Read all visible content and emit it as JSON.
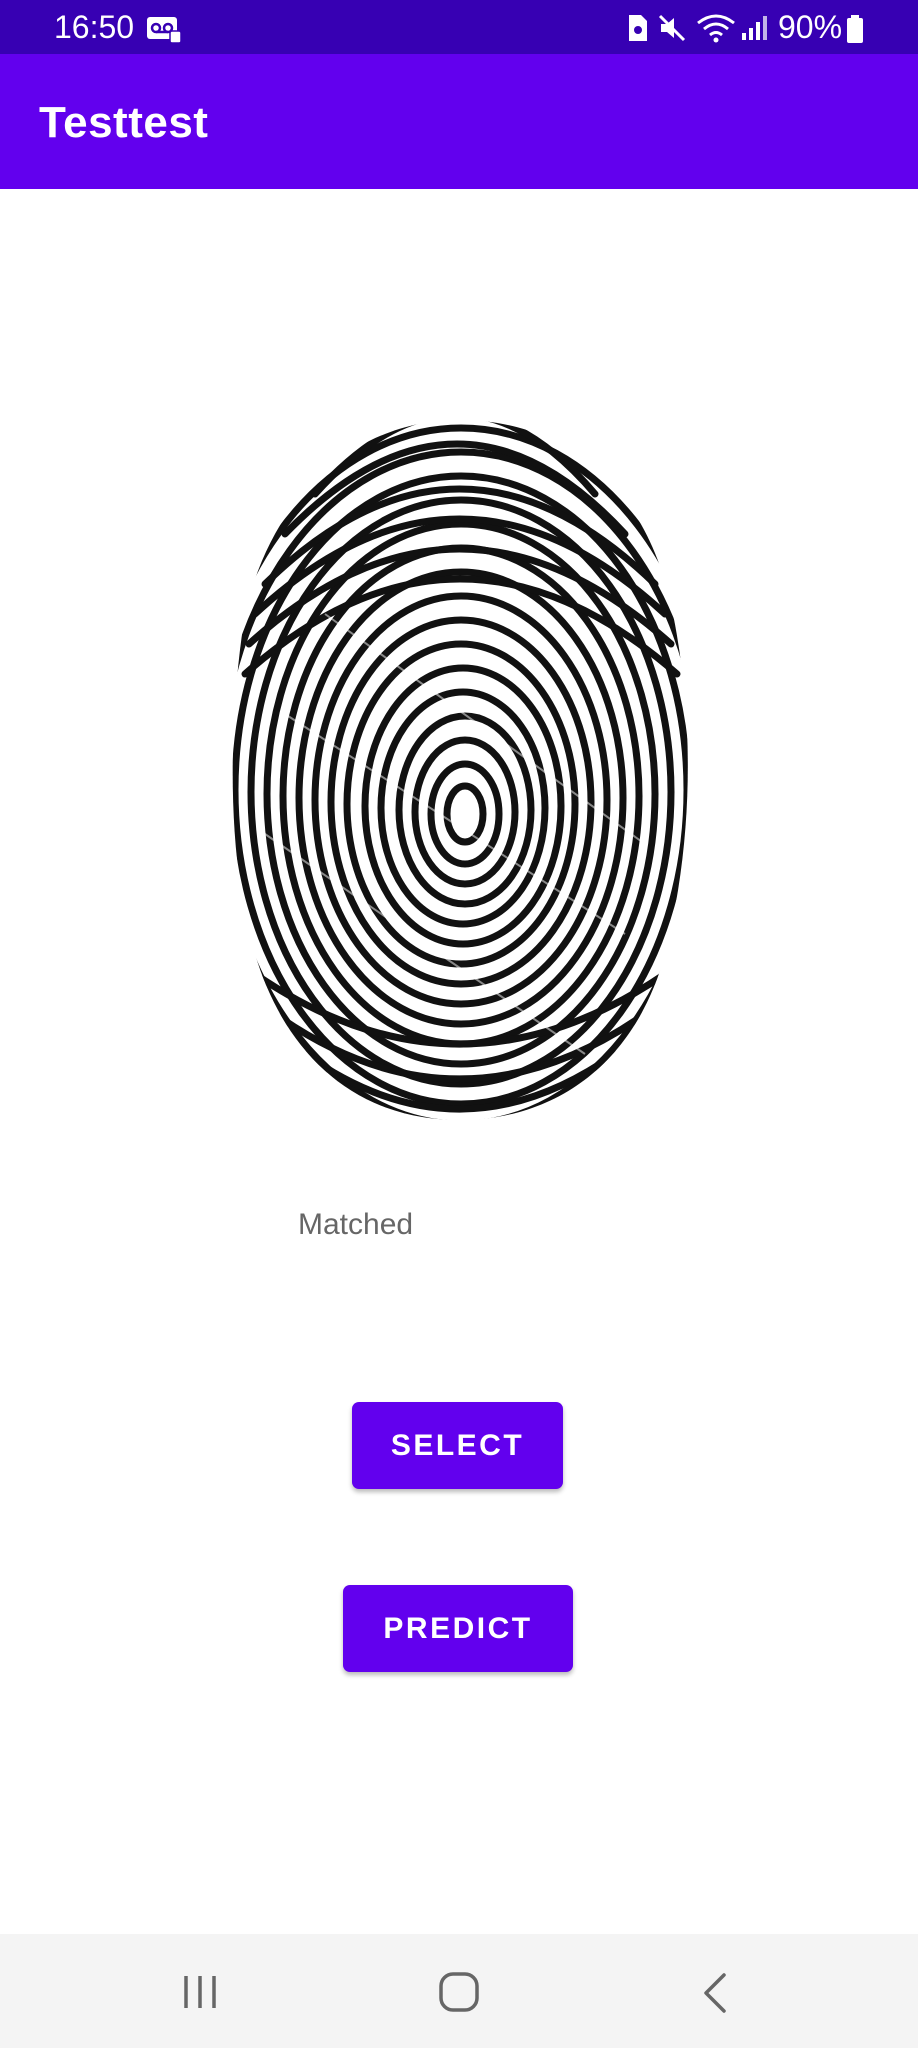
{
  "status_bar": {
    "time": "16:50",
    "battery": "90%",
    "icons": [
      "voicemail-icon",
      "sim-icon",
      "mute-icon",
      "wifi-icon",
      "signal-icon",
      "battery-icon"
    ]
  },
  "app_bar": {
    "title": "Testtest"
  },
  "main": {
    "image": "fingerprint-image",
    "result_text": "Matched",
    "select_label": "SELECT",
    "predict_label": "PREDICT"
  },
  "nav_bar": {
    "icons": [
      "recents-icon",
      "home-icon",
      "back-icon"
    ]
  },
  "colors": {
    "status_bar": "#3700b3",
    "primary": "#6200ee",
    "result_text": "#666666",
    "nav_bg": "#f4f4f4"
  }
}
